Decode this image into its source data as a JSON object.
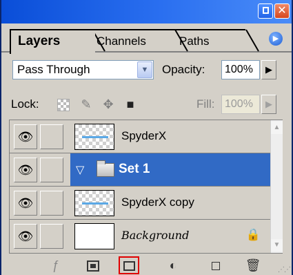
{
  "window": {
    "minimize_label": "",
    "close_label": "✕"
  },
  "tabs": [
    {
      "label": "Layers",
      "active": true
    },
    {
      "label": "Channels",
      "active": false
    },
    {
      "label": "Paths",
      "active": false
    }
  ],
  "tab_menu_glyph": "▶",
  "blend": {
    "mode": "Pass Through",
    "opacity_label": "Opacity:",
    "opacity_value": "100%"
  },
  "lock": {
    "label": "Lock:",
    "fill_label": "Fill:",
    "fill_value": "100%"
  },
  "layers": [
    {
      "name": "SpyderX",
      "thumb": "transparent",
      "visible": true,
      "selected": false
    },
    {
      "name": "Set 1",
      "type": "group",
      "visible": true,
      "selected": true
    },
    {
      "name": "SpyderX copy",
      "thumb": "transparent",
      "visible": true,
      "selected": false
    },
    {
      "name": "Background",
      "thumb": "white",
      "visible": true,
      "selected": false,
      "locked": true
    }
  ],
  "icons": {
    "eye": "eye-icon",
    "lock": "lock-icon",
    "add_style": "layer-style-icon",
    "mask": "add-mask-icon",
    "new_set": "new-set-icon",
    "adjustment": "adjustment-layer-icon",
    "new_layer": "new-layer-icon",
    "trash": "trash-icon"
  },
  "colors": {
    "selection": "#316ac5",
    "highlight_border": "#e00000",
    "titlebar": "#2a6ff0"
  }
}
